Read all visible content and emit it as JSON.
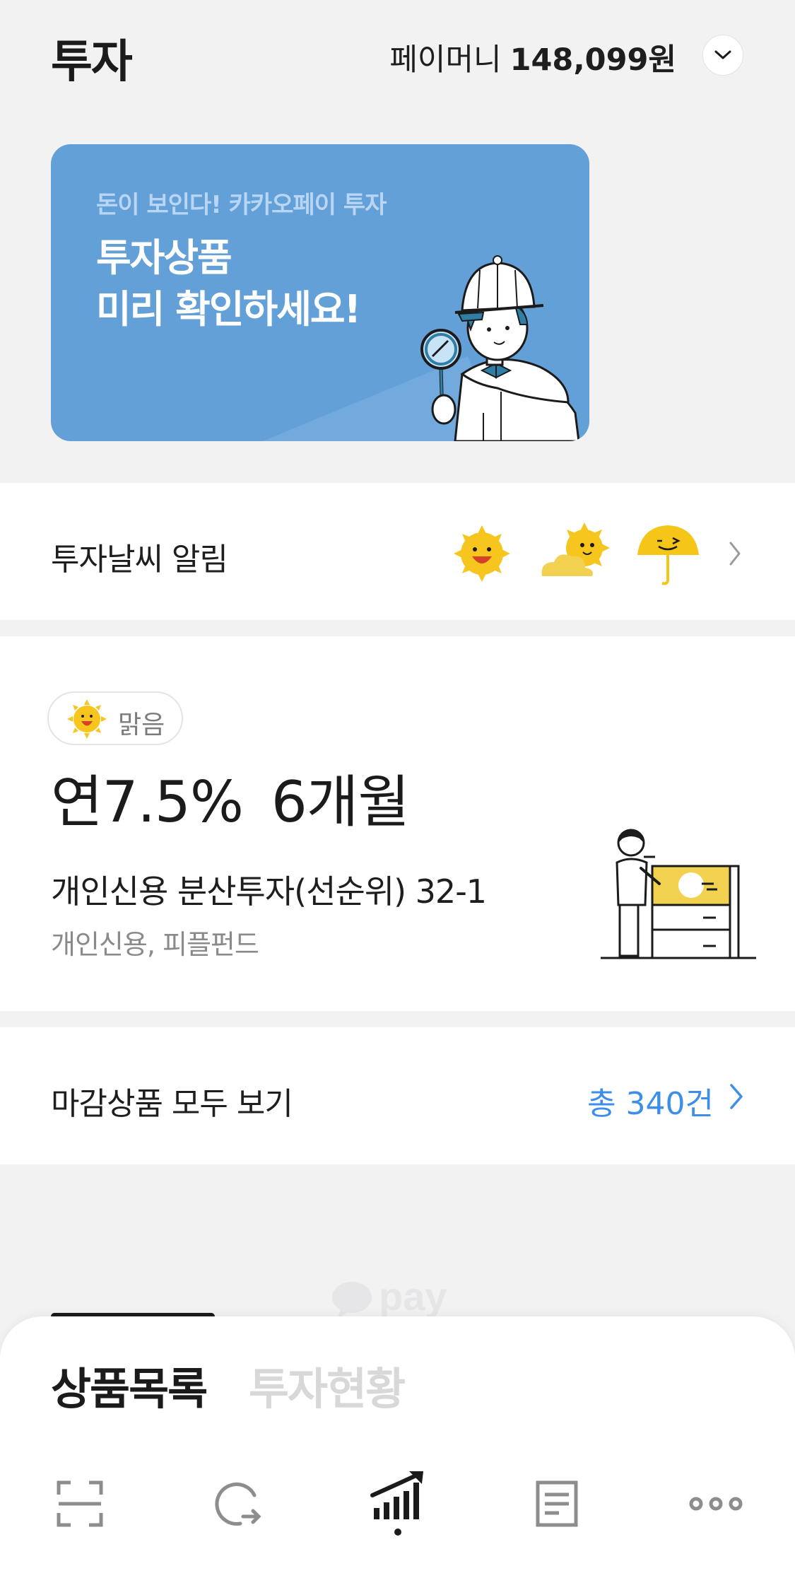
{
  "header": {
    "title": "투자",
    "paymoney_label": "페이머니",
    "paymoney_amount": "148,099원"
  },
  "banner": {
    "subtitle": "돈이 보인다! 카카오페이 투자",
    "title_line1": "투자상품",
    "title_line2": "미리 확인하세요!"
  },
  "weather": {
    "label": "투자날씨 알림",
    "icons": [
      "sun-icon",
      "sun-cloud-icon",
      "umbrella-icon"
    ]
  },
  "product": {
    "badge_label": "맑음",
    "rate": "연7.5%",
    "term": "6개월",
    "name": "개인신용 분산투자(선순위) 32-1",
    "meta": "개인신용, 피플펀드"
  },
  "view_all": {
    "label": "마감상품 모두 보기",
    "count": "총 340건"
  },
  "tabs": {
    "products": "상품목록",
    "status": "투자현황"
  },
  "bottom_nav": [
    "scan-icon",
    "refresh-icon",
    "chart-icon",
    "document-icon",
    "more-icon"
  ],
  "colors": {
    "banner_bg": "#64a0d8",
    "accent_blue": "#3c8ee8",
    "sun_yellow": "#f7c61e",
    "umbrella_yellow": "#f5c518"
  }
}
